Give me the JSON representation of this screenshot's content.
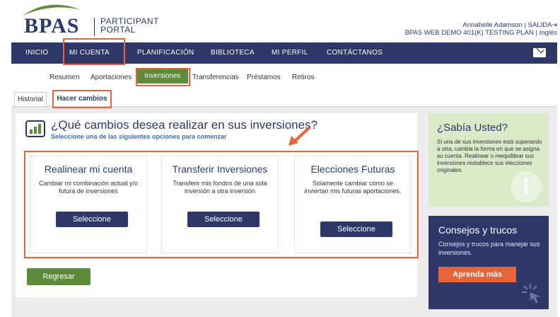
{
  "brand": {
    "name": "BPAS",
    "portal_line1": "PARTICIPANT",
    "portal_line2": "PORTAL",
    "swoosh_color": "#5d8b39",
    "navy": "#2d3869",
    "accent_orange": "#e8643a",
    "green": "#5d8b39"
  },
  "user": {
    "name": "Annabelle Adamson",
    "separator": "|",
    "logout": "SALIDA",
    "logout_icon": "logout-icon",
    "plan": "BPAS WEB DEMO 401(K) TESTING PLAN",
    "language": "Inglés"
  },
  "nav": {
    "items": [
      "INICIO",
      "MI CUENTA",
      "PLANIFICACIÓN",
      "BIBLIOTECA",
      "MI PERFIL",
      "CONTÁCTANOS"
    ],
    "active": "MI CUENTA",
    "mail_icon": "mail-icon"
  },
  "subnav": {
    "items": [
      "Resumen",
      "Aportaciones",
      "Inversiones",
      "Transferencias",
      "Préstamos",
      "Retiros"
    ],
    "active": "Inversiones"
  },
  "tabs": {
    "items": [
      "Historial",
      "Hacer cambios"
    ],
    "active": "Hacer cambios"
  },
  "main": {
    "icon": "chart-icon",
    "question": "¿Qué cambios desea realizar en sus inversiones?",
    "subtitle": "Seleccione una de las siguientes opciones para comenzar",
    "options": [
      {
        "title": "Realinear mi cuenta",
        "text": "Cambiar mi combinación actual y/o futura de inversiones",
        "button": "Seleccione"
      },
      {
        "title": "Transferir Inversiones",
        "text": "Transferir mis fondos de una sola inversión a otra inversión",
        "button": "Seleccione"
      },
      {
        "title": "Elecciones Futuras",
        "text": "Solamente cambiar cómo se inviertan mis futuras aportaciones.",
        "button": "Seleccione"
      }
    ],
    "back_button": "Regresar"
  },
  "sidebar": {
    "tip_title": "¿Sabía Usted?",
    "tip_text": "Si una de sus inversiones está superando a otra, cambia la forma en que se asigna su cuenta. Realinear o reequilibrar sus inversiones restablece sus elecciones originales.",
    "tip_icon": "i",
    "tricks_title": "Consejos y trucos",
    "tricks_text": "Consejos y trucos para manejar sus inversiones.",
    "tricks_button": "Aprenda más",
    "tricks_icon": "click-icon"
  }
}
